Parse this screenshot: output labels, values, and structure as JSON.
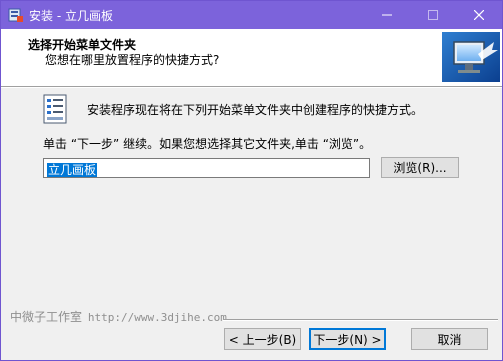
{
  "window": {
    "title": "安装 - 立几画板",
    "controls": {
      "minimize": "—",
      "maximize": "☐",
      "close": "✕"
    }
  },
  "header": {
    "title": "选择开始菜单文件夹",
    "subtitle": "您想在哪里放置程序的快捷方式?"
  },
  "content": {
    "intro": "安装程序现在将在下列开始菜单文件夹中创建程序的快捷方式。",
    "instruction": "单击 “下一步” 继续。如果您想选择其它文件夹,单击 “浏览”。",
    "folder_value": "立几画板",
    "browse_label": "浏览(R)..."
  },
  "footer": {
    "brand_name": "中微子工作室",
    "brand_url": "http://www.3djihe.com",
    "back_label": "< 上一步(B)",
    "next_label": "下一步(N) >",
    "cancel_label": "取消"
  },
  "icons": [
    "app-icon",
    "minimize-icon",
    "maximize-icon",
    "close-icon",
    "monitor-header-icon",
    "shortcut-list-icon"
  ],
  "colors": {
    "titlebar": "#7c63db",
    "selection": "#0078d7",
    "default_button_border": "#0078d7"
  }
}
